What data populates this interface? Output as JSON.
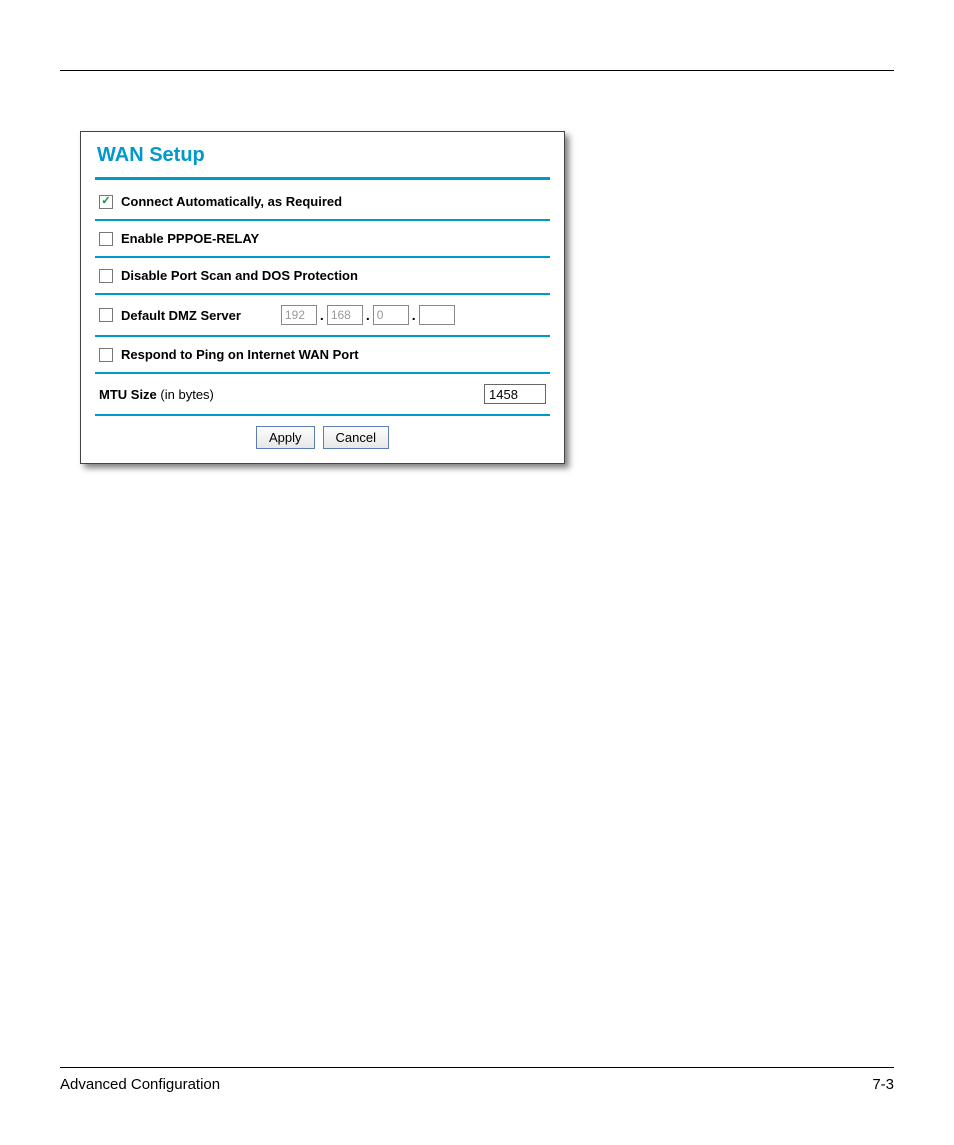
{
  "panel": {
    "title": "WAN Setup",
    "rows": {
      "connect_auto": {
        "label": "Connect Automatically, as Required",
        "checked": true
      },
      "pppoe_relay": {
        "label": "Enable PPPOE-RELAY",
        "checked": false
      },
      "disable_portscan": {
        "label": "Disable Port Scan and DOS Protection",
        "checked": false
      },
      "dmz": {
        "label": "Default DMZ Server",
        "checked": false,
        "ip": {
          "a": "192",
          "b": "168",
          "c": "0",
          "d": ""
        }
      },
      "respond_ping": {
        "label": "Respond to Ping on Internet WAN Port",
        "checked": false
      },
      "mtu": {
        "label": "MTU Size",
        "note": "(in bytes)",
        "value": "1458"
      }
    },
    "buttons": {
      "apply": "Apply",
      "cancel": "Cancel"
    }
  },
  "footer": {
    "left": "Advanced Configuration",
    "right": "7-3"
  }
}
